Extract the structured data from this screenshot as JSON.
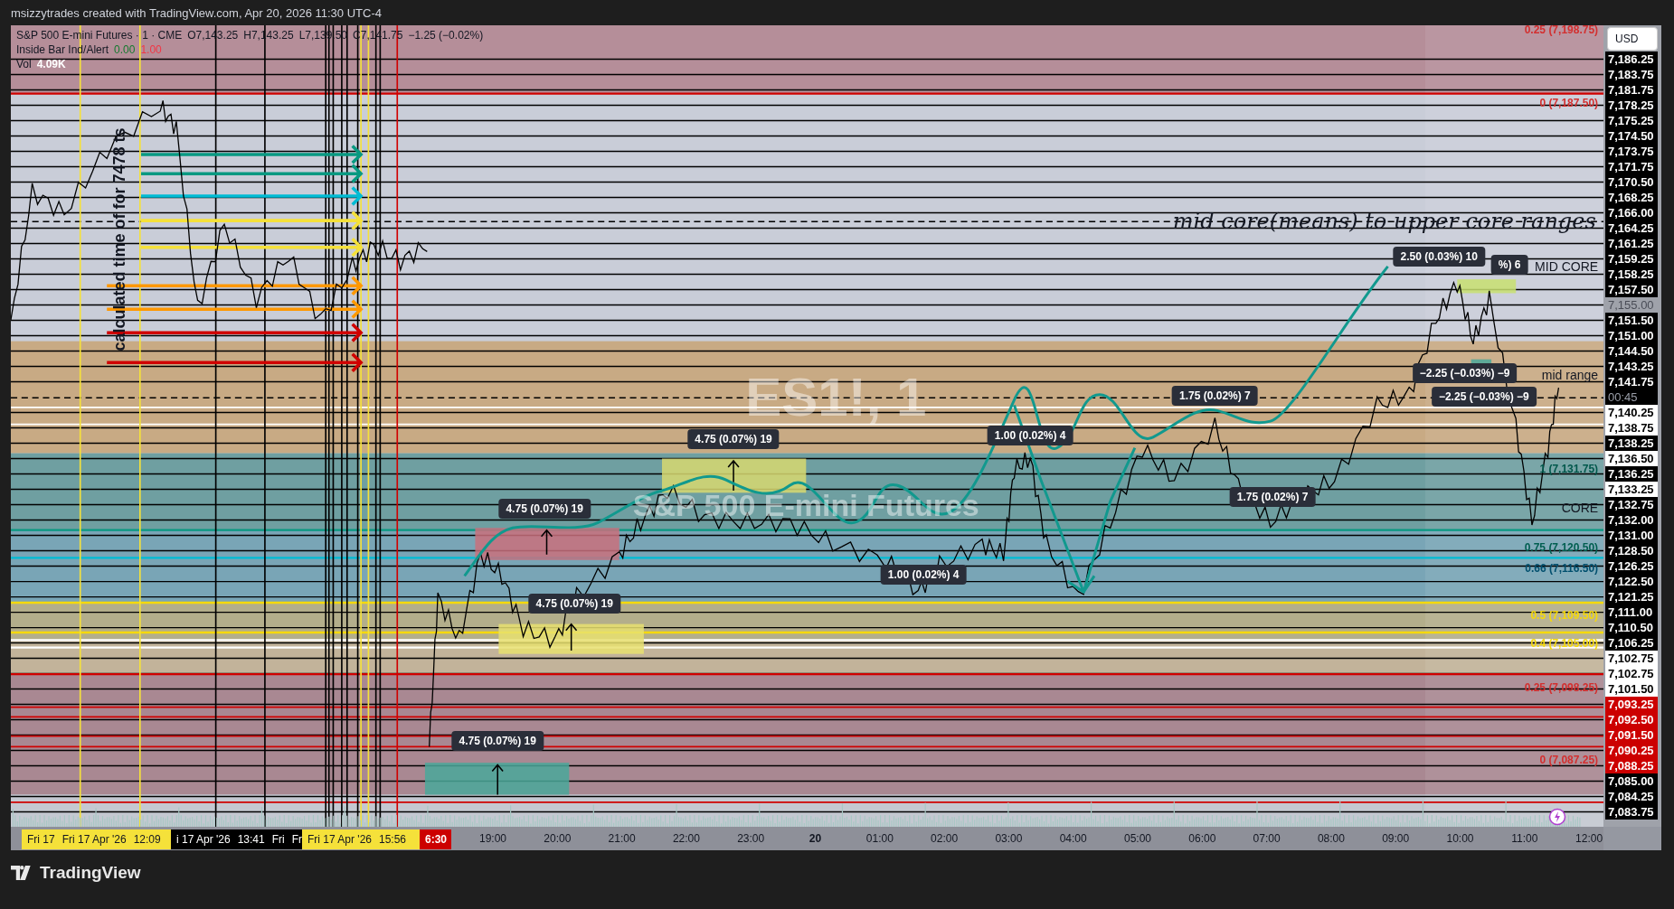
{
  "header": {
    "text": "msizzytrades created with TradingView.com, Apr 20, 2026 11:30 UTC-4"
  },
  "legend": {
    "symbol": "S&P 500 E-mini Futures · 1 · CME",
    "ohlc": [
      {
        "label": "O",
        "value": "7,143.25"
      },
      {
        "label": "H",
        "value": "7,143.25"
      },
      {
        "label": "L",
        "value": "7,139.50"
      },
      {
        "label": "C",
        "value": "7,141.75"
      }
    ],
    "change": "−1.25 (−0.02%)",
    "indicator": {
      "name": "Inside Bar Ind/Alert",
      "values": [
        {
          "text": "0.00",
          "color": "#137a2e"
        },
        {
          "text": "1.00",
          "color": "#f23645"
        }
      ]
    },
    "volume": {
      "label": "Vol",
      "value": "4.09K"
    }
  },
  "watermark": {
    "symbol": "ES1!, 1",
    "description": "S&P 500 E-mini Futures"
  },
  "annotations": [
    {
      "kind": "heading",
      "text": "mid core(means) to upper core ranges"
    },
    {
      "kind": "zone",
      "text": "MID CORE"
    },
    {
      "kind": "zone",
      "text": "mid range"
    },
    {
      "kind": "zone",
      "text": "CORE"
    },
    {
      "kind": "vertical",
      "text": "calculated time of for 7478 ts"
    }
  ],
  "fib_levels": [
    {
      "text": "0.25 (7,198.75)",
      "color": "#d32f2f"
    },
    {
      "text": "0 (7,187.50)",
      "color": "#d32f2f"
    },
    {
      "text": "1 (7,131.75)",
      "color": "#00574b"
    },
    {
      "text": "0.75 (7,120.50)",
      "color": "#005e50"
    },
    {
      "text": "0.66 (7,116.50)",
      "color": "#004f6e"
    },
    {
      "text": "0.5 (7,109.50)",
      "color": "#f5d90a"
    },
    {
      "text": "0.4 (7,105.00)",
      "color": "#f5d90a"
    },
    {
      "text": "0.25 (7,098.25)",
      "color": "#d32f2f"
    },
    {
      "text": "0 (7,087.25)",
      "color": "#d32f2f"
    }
  ],
  "measurements": [
    {
      "text": "4.75 (0.07%) 19"
    },
    {
      "text": "4.75 (0.07%) 19"
    },
    {
      "text": "4.75 (0.07%) 19"
    },
    {
      "text": "4.75 (0.07%) 19"
    },
    {
      "text": "1.00 (0.02%) 4"
    },
    {
      "text": "1.00 (0.02%) 4"
    },
    {
      "text": "1.75 (0.02%) 7"
    },
    {
      "text": "1.75 (0.02%) 7"
    },
    {
      "text": "2.50 (0.03%) 10"
    },
    {
      "text": "%) 6"
    },
    {
      "text": "−2.25 (−0.03%) −9"
    },
    {
      "text": "−2.25 (−0.03%) −9"
    }
  ],
  "price_axis": {
    "currency": "USD",
    "labels": [
      {
        "text": "7,186.25",
        "kind": "black"
      },
      {
        "text": "7,183.75",
        "kind": "black"
      },
      {
        "text": "7,181.75",
        "kind": "black"
      },
      {
        "text": "7,178.25",
        "kind": "black"
      },
      {
        "text": "7,175.25",
        "kind": "black"
      },
      {
        "text": "7,174.50",
        "kind": "black"
      },
      {
        "text": "7,173.75",
        "kind": "black"
      },
      {
        "text": "7,171.75",
        "kind": "black"
      },
      {
        "text": "7,170.50",
        "kind": "black"
      },
      {
        "text": "7,168.25",
        "kind": "black"
      },
      {
        "text": "7,166.00",
        "kind": "black"
      },
      {
        "text": "7,164.25",
        "kind": "black"
      },
      {
        "text": "7,161.25",
        "kind": "black"
      },
      {
        "text": "7,159.25",
        "kind": "black"
      },
      {
        "text": "7,158.25",
        "kind": "black"
      },
      {
        "text": "7,157.50",
        "kind": "black"
      },
      {
        "text": "7,155.00",
        "kind": "plain"
      },
      {
        "text": "7,151.50",
        "kind": "black"
      },
      {
        "text": "7,151.00",
        "kind": "black"
      },
      {
        "text": "7,144.50",
        "kind": "black"
      },
      {
        "text": "7,143.25",
        "kind": "black"
      },
      {
        "text": "7,141.75",
        "kind": "black",
        "countdown": "00:45"
      },
      {
        "text": "7,140.25",
        "kind": "white"
      },
      {
        "text": "7,138.75",
        "kind": "white"
      },
      {
        "text": "7,138.25",
        "kind": "black"
      },
      {
        "text": "7,136.50",
        "kind": "white"
      },
      {
        "text": "7,136.25",
        "kind": "black"
      },
      {
        "text": "7,133.25",
        "kind": "white"
      },
      {
        "text": "7,132.75",
        "kind": "black"
      },
      {
        "text": "7,132.00",
        "kind": "black"
      },
      {
        "text": "7,131.00",
        "kind": "black"
      },
      {
        "text": "7,128.50",
        "kind": "black"
      },
      {
        "text": "7,126.25",
        "kind": "black"
      },
      {
        "text": "7,122.50",
        "kind": "black"
      },
      {
        "text": "7,121.25",
        "kind": "black"
      },
      {
        "text": "7,111.00",
        "kind": "black"
      },
      {
        "text": "7,110.50",
        "kind": "black"
      },
      {
        "text": "7,106.25",
        "kind": "black"
      },
      {
        "text": "7,102.75",
        "kind": "white"
      },
      {
        "text": "7,102.75",
        "kind": "white"
      },
      {
        "text": "7,101.50",
        "kind": "white"
      },
      {
        "text": "7,093.25",
        "kind": "red"
      },
      {
        "text": "7,092.50",
        "kind": "red"
      },
      {
        "text": "7,091.50",
        "kind": "red"
      },
      {
        "text": "7,090.25",
        "kind": "red"
      },
      {
        "text": "7,088.25",
        "kind": "red"
      },
      {
        "text": "7,085.00",
        "kind": "black"
      },
      {
        "text": "7,084.25",
        "kind": "black"
      },
      {
        "text": "7,083.75",
        "kind": "black"
      }
    ]
  },
  "time_axis": {
    "highlights": [
      {
        "kind": "yellow",
        "texts": [
          "Fri 17",
          "Fri 17 Apr '26",
          "12:09"
        ]
      },
      {
        "kind": "black",
        "texts": [
          "i 17 Apr '26",
          "13:41",
          "Fri",
          "Fr"
        ]
      },
      {
        "kind": "yellow",
        "texts": [
          "Fri 17 Apr '26",
          "15:56"
        ]
      },
      {
        "kind": "red",
        "texts": [
          "6:30"
        ]
      }
    ],
    "ticks": [
      {
        "text": "19:00",
        "bold": false
      },
      {
        "text": "20:00",
        "bold": false
      },
      {
        "text": "21:00",
        "bold": false
      },
      {
        "text": "22:00",
        "bold": false
      },
      {
        "text": "23:00",
        "bold": false
      },
      {
        "text": "20",
        "bold": true
      },
      {
        "text": "01:00",
        "bold": false
      },
      {
        "text": "02:00",
        "bold": false
      },
      {
        "text": "03:00",
        "bold": false
      },
      {
        "text": "04:00",
        "bold": false
      },
      {
        "text": "05:00",
        "bold": false
      },
      {
        "text": "06:00",
        "bold": false
      },
      {
        "text": "07:00",
        "bold": false
      },
      {
        "text": "08:00",
        "bold": false
      },
      {
        "text": "09:00",
        "bold": false
      },
      {
        "text": "10:00",
        "bold": false
      },
      {
        "text": "11:00",
        "bold": false
      },
      {
        "text": "12:00",
        "bold": false
      }
    ]
  },
  "footer": {
    "brand": "TradingView"
  }
}
